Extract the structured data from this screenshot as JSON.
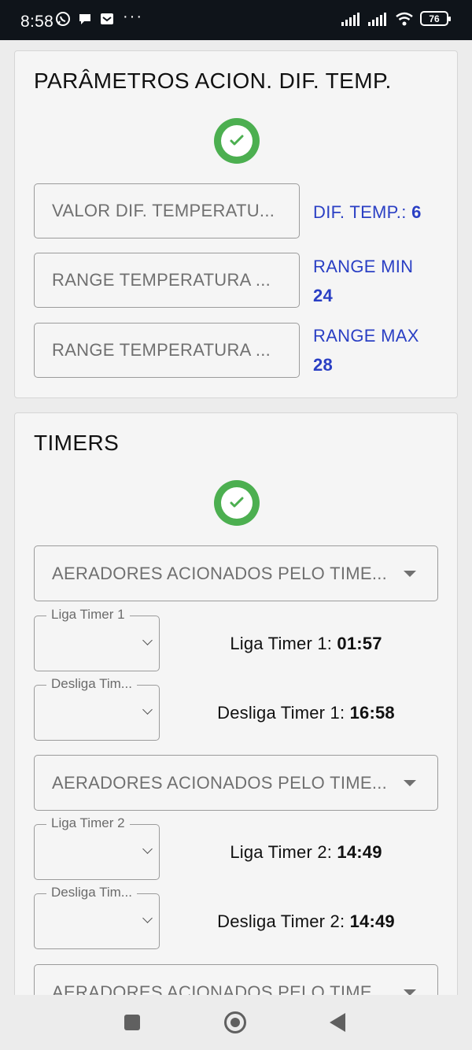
{
  "status_bar": {
    "time": "8:58",
    "battery": "76",
    "more": "···"
  },
  "params_card": {
    "title": "PARÂMETROS ACION. DIF. TEMP.",
    "fields": [
      {
        "placeholder": "VALOR DIF. TEMPERATU...",
        "label": "DIF. TEMP.:",
        "value": "6"
      },
      {
        "placeholder": "RANGE TEMPERATURA ...",
        "label": "RANGE MIN",
        "value": "24"
      },
      {
        "placeholder": "RANGE TEMPERATURA ...",
        "label": "RANGE MAX",
        "value": "28"
      }
    ]
  },
  "timers_card": {
    "title": "TIMERS",
    "groups": [
      {
        "select": "AERADORES ACIONADOS PELO TIME...",
        "on_legend": "Liga Timer 1",
        "on_label": "Liga Timer 1:",
        "on_value": "01:57",
        "off_legend": "Desliga Tim...",
        "off_label": "Desliga Timer 1:",
        "off_value": "16:58"
      },
      {
        "select": "AERADORES ACIONADOS PELO TIME...",
        "on_legend": "Liga Timer 2",
        "on_label": "Liga Timer 2:",
        "on_value": "14:49",
        "off_legend": "Desliga Tim...",
        "off_label": "Desliga Timer 2:",
        "off_value": "14:49"
      },
      {
        "select": "AERADORES ACIONADOS PELO TIME..."
      }
    ]
  },
  "colors": {
    "accent_blue": "#2a3fc4",
    "success_green": "#4caf50"
  }
}
